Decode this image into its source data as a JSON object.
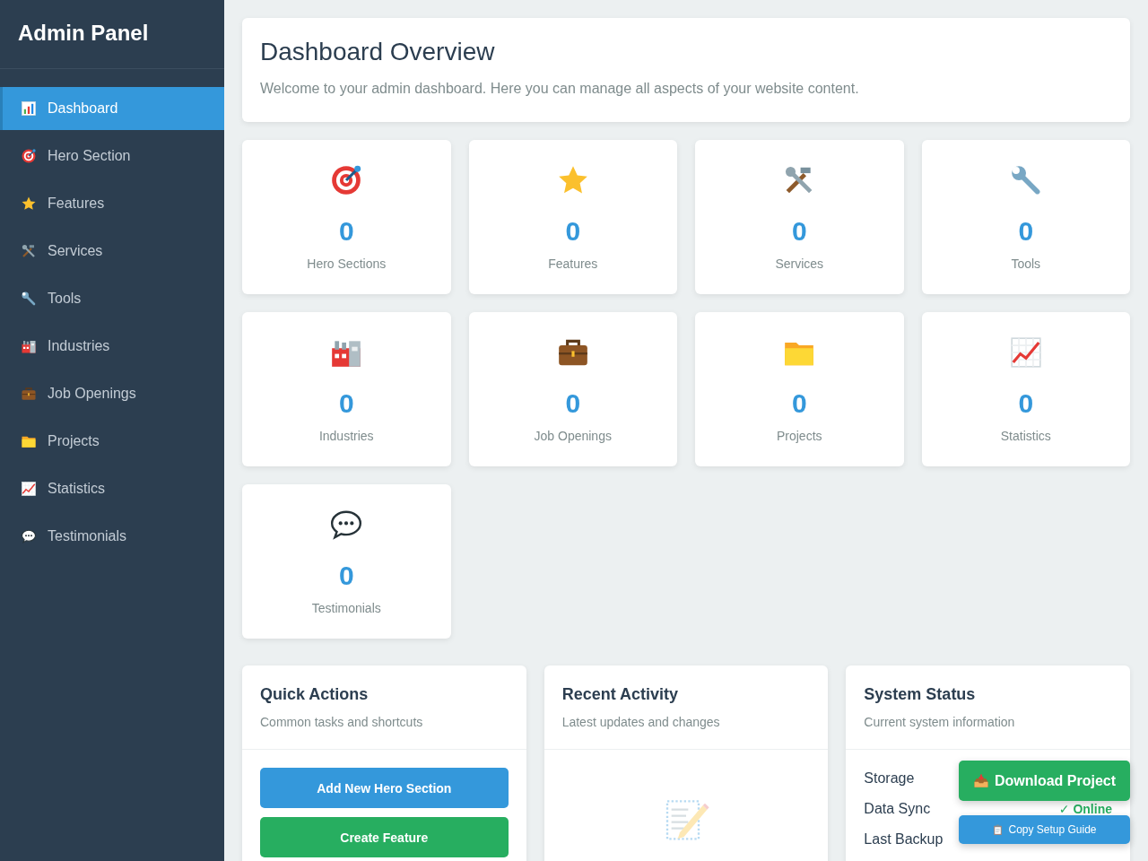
{
  "sidebar": {
    "title": "Admin Panel",
    "items": [
      {
        "label": "Dashboard",
        "selected": true
      },
      {
        "label": "Hero Section",
        "selected": false
      },
      {
        "label": "Features",
        "selected": false
      },
      {
        "label": "Services",
        "selected": false
      },
      {
        "label": "Tools",
        "selected": false
      },
      {
        "label": "Industries",
        "selected": false
      },
      {
        "label": "Job Openings",
        "selected": false
      },
      {
        "label": "Projects",
        "selected": false
      },
      {
        "label": "Statistics",
        "selected": false
      },
      {
        "label": "Testimonials",
        "selected": false
      }
    ]
  },
  "welcome": {
    "title": "Dashboard Overview",
    "text": "Welcome to your admin dashboard. Here you can manage all aspects of your website content."
  },
  "stats": [
    {
      "count": "0",
      "label": "Hero Sections"
    },
    {
      "count": "0",
      "label": "Features"
    },
    {
      "count": "0",
      "label": "Services"
    },
    {
      "count": "0",
      "label": "Tools"
    },
    {
      "count": "0",
      "label": "Industries"
    },
    {
      "count": "0",
      "label": "Job Openings"
    },
    {
      "count": "0",
      "label": "Projects"
    },
    {
      "count": "0",
      "label": "Statistics"
    },
    {
      "count": "0",
      "label": "Testimonials"
    }
  ],
  "quick_actions": {
    "title": "Quick Actions",
    "subtitle": "Common tasks and shortcuts",
    "buttons": [
      {
        "label": "Add New Hero Section",
        "color": "#3498db"
      },
      {
        "label": "Create Feature",
        "color": "#27ae60"
      }
    ]
  },
  "recent_activity": {
    "title": "Recent Activity",
    "subtitle": "Latest updates and changes"
  },
  "system_status": {
    "title": "System Status",
    "subtitle": "Current system information",
    "rows": [
      {
        "label": "Storage"
      },
      {
        "label": "Data Sync",
        "value": "✓ Online"
      },
      {
        "label": "Last Backup"
      }
    ]
  },
  "floating": {
    "download": "Download Project",
    "copy": "Copy Setup Guide"
  }
}
